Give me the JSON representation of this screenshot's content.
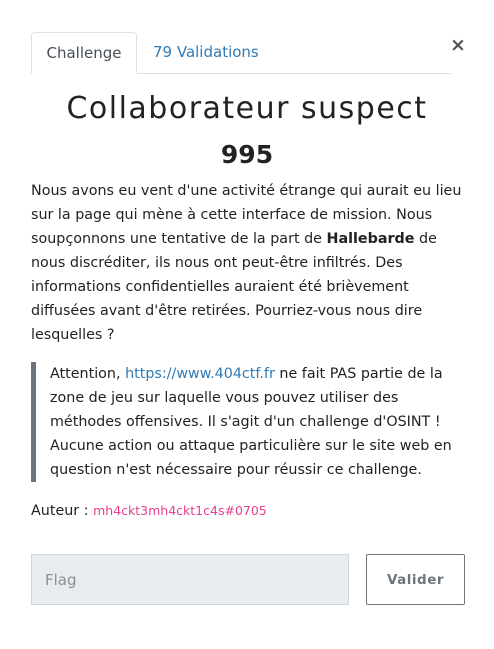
{
  "close": {
    "glyph": "×"
  },
  "tabs": [
    {
      "label": "Challenge",
      "active": true
    },
    {
      "label": "79 Validations",
      "active": false
    }
  ],
  "challenge": {
    "title": "Collaborateur suspect",
    "points": "995",
    "description": {
      "part1": "Nous avons eu vent d'une activité étrange qui aurait eu lieu sur la page qui mène à cette interface de mission. Nous soupçonnons une tentative de la part de ",
      "bold": "Hallebarde",
      "part2": " de nous discréditer, ils nous ont peut-être infiltrés. Des informations confidentielles auraient été brièvement diffusées avant d'être retirées. Pourriez-vous nous dire lesquelles ?"
    },
    "notice": {
      "prefix": "Attention, ",
      "link": "https://www.404ctf.fr",
      "suffix": " ne fait PAS partie de la zone de jeu sur laquelle vous pouvez utiliser des méthodes offensives. Il s'agit d'un challenge d'OSINT ! Aucune action ou attaque particulière sur le site web en question n'est nécessaire pour réussir ce challenge."
    },
    "author_label": "Auteur : ",
    "author": "mh4ckt3mh4ckt1c4s#0705"
  },
  "form": {
    "flag_value": "",
    "flag_placeholder": "Flag",
    "submit_label": "Valider"
  },
  "colors": {
    "link": "#2f7bb6",
    "author": "#e83e8c",
    "quote_border": "#6c757d",
    "input_bg": "#e9ecef"
  }
}
